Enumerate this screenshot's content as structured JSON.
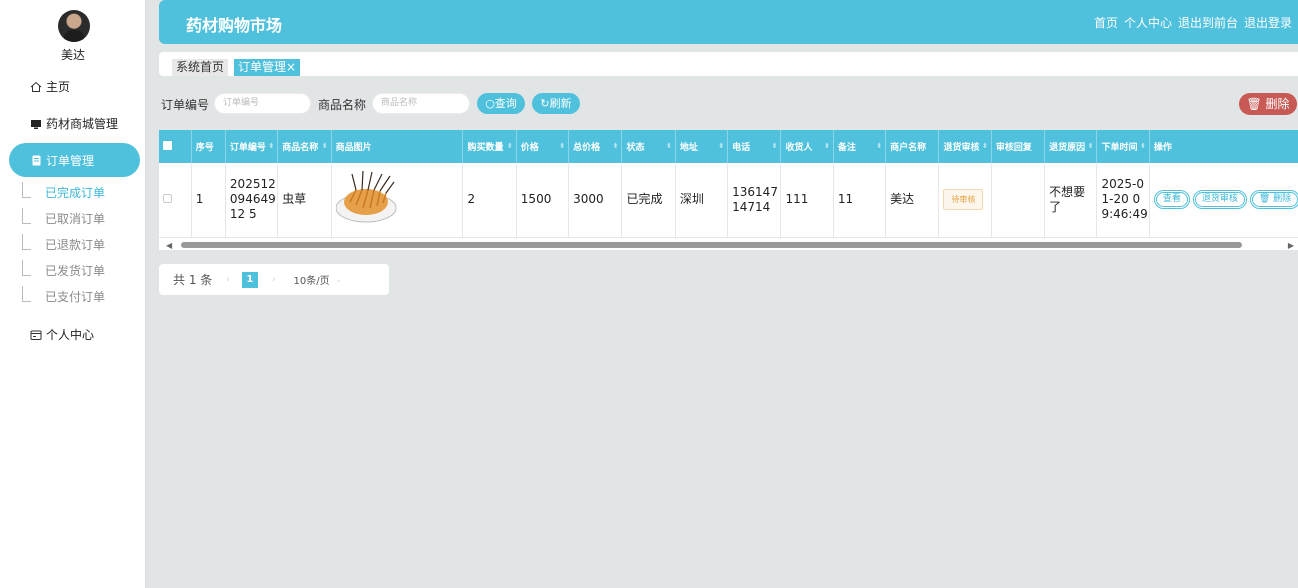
{
  "sidebar": {
    "username": "美达",
    "home": "主页",
    "shop_manage": "药材商城管理",
    "order_manage": "订单管理",
    "sub_items": [
      "已完成订单",
      "已取消订单",
      "已退款订单",
      "已发货订单",
      "已支付订单"
    ],
    "personal": "个人中心"
  },
  "header": {
    "title": "药材购物市场",
    "links": [
      "首页",
      "个人中心",
      "退出到前台",
      "退出登录"
    ]
  },
  "tabs": {
    "home": "系统首页",
    "orders": "订单管理"
  },
  "search": {
    "order_no_label": "订单编号",
    "order_no_placeholder": "订单编号",
    "product_label": "商品名称",
    "product_placeholder": "商品名称",
    "query": "查询",
    "refresh": "刷新",
    "delete": "删除"
  },
  "table": {
    "columns": [
      "序号",
      "订单编号",
      "商品名称",
      "商品图片",
      "购买数量",
      "价格",
      "总价格",
      "状态",
      "地址",
      "电话",
      "收货人",
      "备注",
      "商户名称",
      "退货审核",
      "审核回复",
      "退货原因",
      "下单时间",
      "操作"
    ],
    "rows": [
      {
        "index": "1",
        "order_no": "20251209464912 5",
        "product": "虫草",
        "qty": "2",
        "price": "1500",
        "total": "3000",
        "status": "已完成",
        "address": "深圳",
        "phone": "13614714714",
        "receiver": "111",
        "remark": "11",
        "merchant": "美达",
        "return_review": "待审核",
        "review_reply": "",
        "return_reason": "不想要了",
        "order_time": "2025-01-20 09:46:49",
        "ops": [
          "查看",
          "退货审核",
          "删除"
        ]
      }
    ]
  },
  "pager": {
    "total": "共 1 条",
    "current": "1",
    "page_size": "10条/页"
  },
  "colors": {
    "accent": "#4fc1dd",
    "danger": "#c85a56",
    "warning": "#e6a23c"
  }
}
